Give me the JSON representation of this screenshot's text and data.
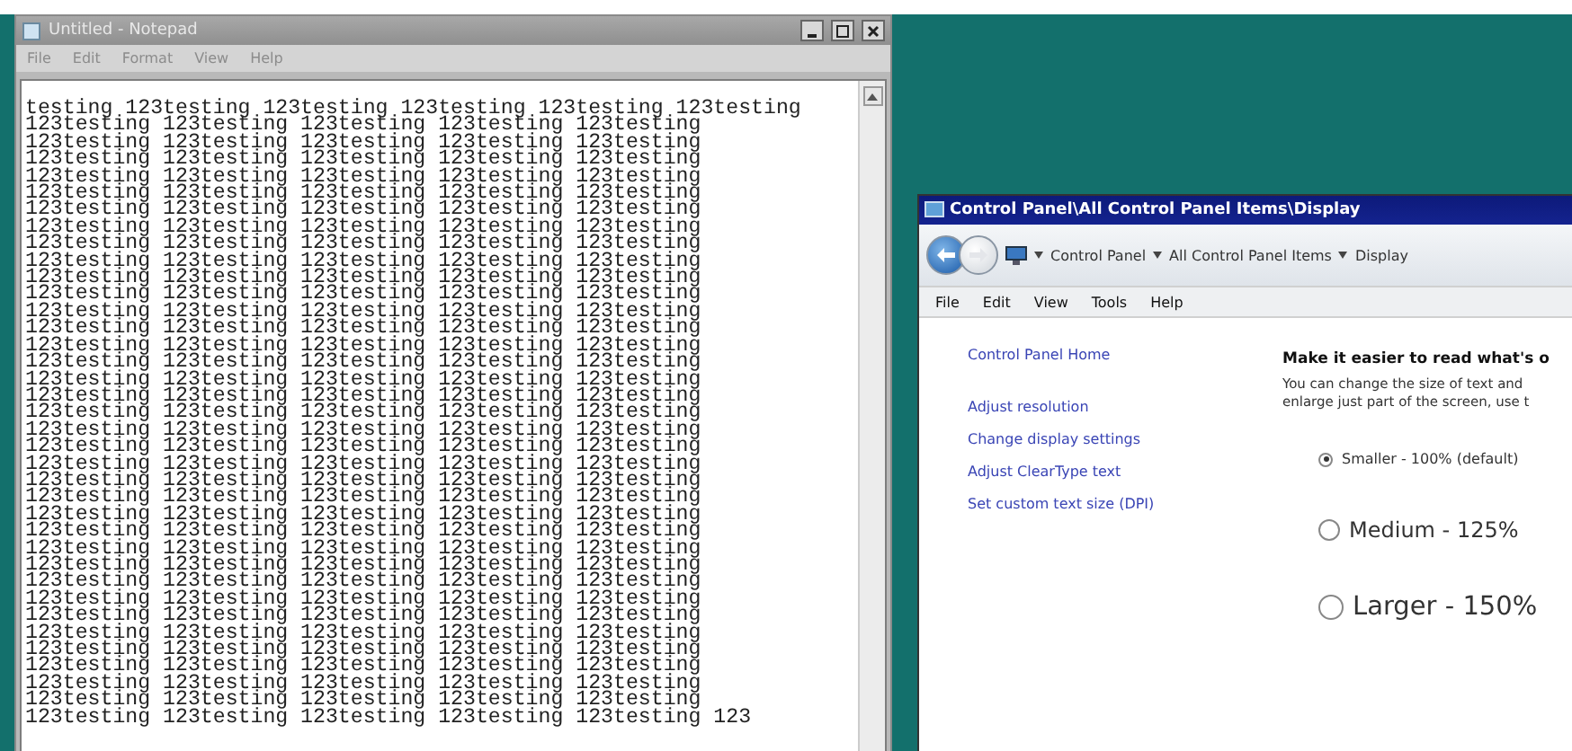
{
  "notepad": {
    "title": "Untitled - Notepad",
    "menu": [
      "File",
      "Edit",
      "Format",
      "View",
      "Help"
    ],
    "text": "testing 123testing 123testing 123testing 123testing 123testing\n123testing 123testing 123testing 123testing 123testing\n123testing 123testing 123testing 123testing 123testing\n123testing 123testing 123testing 123testing 123testing\n123testing 123testing 123testing 123testing 123testing\n123testing 123testing 123testing 123testing 123testing\n123testing 123testing 123testing 123testing 123testing\n123testing 123testing 123testing 123testing 123testing\n123testing 123testing 123testing 123testing 123testing\n123testing 123testing 123testing 123testing 123testing\n123testing 123testing 123testing 123testing 123testing\n123testing 123testing 123testing 123testing 123testing\n123testing 123testing 123testing 123testing 123testing\n123testing 123testing 123testing 123testing 123testing\n123testing 123testing 123testing 123testing 123testing\n123testing 123testing 123testing 123testing 123testing\n123testing 123testing 123testing 123testing 123testing\n123testing 123testing 123testing 123testing 123testing\n123testing 123testing 123testing 123testing 123testing\n123testing 123testing 123testing 123testing 123testing\n123testing 123testing 123testing 123testing 123testing\n123testing 123testing 123testing 123testing 123testing\n123testing 123testing 123testing 123testing 123testing\n123testing 123testing 123testing 123testing 123testing\n123testing 123testing 123testing 123testing 123testing\n123testing 123testing 123testing 123testing 123testing\n123testing 123testing 123testing 123testing 123testing\n123testing 123testing 123testing 123testing 123testing\n123testing 123testing 123testing 123testing 123testing\n123testing 123testing 123testing 123testing 123testing\n123testing 123testing 123testing 123testing 123testing\n123testing 123testing 123testing 123testing 123testing\n123testing 123testing 123testing 123testing 123testing\n123testing 123testing 123testing 123testing 123testing\n123testing 123testing 123testing 123testing 123testing\n123testing 123testing 123testing 123testing 123testing\n123testing 123testing 123testing 123testing 123testing 123"
  },
  "control_panel": {
    "title": "Control Panel\\All Control Panel Items\\Display",
    "breadcrumbs": [
      "Control Panel",
      "All Control Panel Items",
      "Display"
    ],
    "menu": [
      "File",
      "Edit",
      "View",
      "Tools",
      "Help"
    ],
    "home_link": "Control Panel Home",
    "links": [
      "Adjust resolution",
      "Change display settings",
      "Adjust ClearType text",
      "Set custom text size (DPI)"
    ],
    "heading": "Make it easier to read what's o",
    "description": [
      "You can change the size of text and",
      "enlarge just part of the screen, use t"
    ],
    "options": [
      {
        "label": "Smaller - 100% (default)",
        "selected": true
      },
      {
        "label": "Medium - 125%",
        "selected": false
      },
      {
        "label": "Larger - 150%",
        "selected": false
      }
    ]
  }
}
